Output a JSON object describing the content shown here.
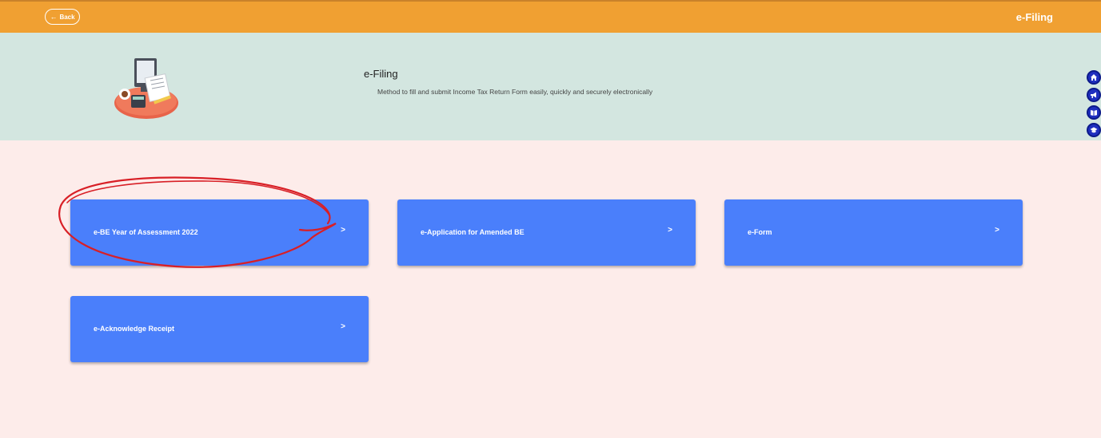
{
  "header": {
    "back_label": "Back",
    "title": "e-Filing",
    "bar_color": "#f0a032"
  },
  "banner": {
    "title": "e-Filing",
    "subtitle": "Method to fill and submit Income Tax Return Form easily, quickly and securely electronically",
    "background": "#d3e6e0"
  },
  "side_nav": [
    {
      "icon": "home-icon"
    },
    {
      "icon": "megaphone-icon"
    },
    {
      "icon": "book-icon"
    },
    {
      "icon": "graduation-cap-icon"
    }
  ],
  "cards": [
    {
      "label": "e-BE Year of Assessment 2022",
      "chevron": ">"
    },
    {
      "label": "e-Application for Amended BE",
      "chevron": ">"
    },
    {
      "label": "e-Form",
      "chevron": ">"
    },
    {
      "label": "e-Acknowledge Receipt",
      "chevron": ">"
    }
  ],
  "colors": {
    "card": "#4a7ffb",
    "page_background": "#fdecea",
    "side_nav": "#1f2fbf",
    "annotation": "#d81f26"
  }
}
